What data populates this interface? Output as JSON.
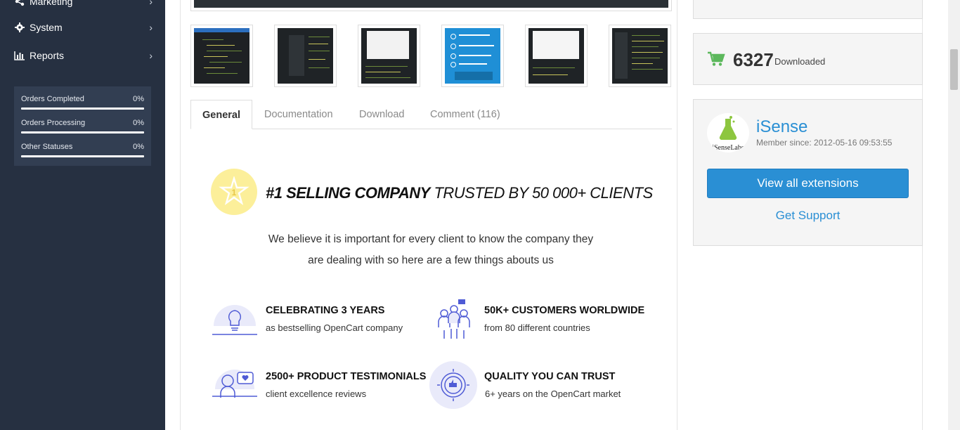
{
  "sidebar": {
    "items": [
      {
        "label": "Marketing",
        "icon": "share-icon"
      },
      {
        "label": "System",
        "icon": "gear-icon"
      },
      {
        "label": "Reports",
        "icon": "bar-chart-icon"
      }
    ],
    "stats": [
      {
        "label": "Orders Completed",
        "percent": "0%"
      },
      {
        "label": "Orders Processing",
        "percent": "0%"
      },
      {
        "label": "Other Statuses",
        "percent": "0%"
      }
    ]
  },
  "tabs": [
    {
      "label": "General",
      "active": true
    },
    {
      "label": "Documentation",
      "active": false
    },
    {
      "label": "Download",
      "active": false
    },
    {
      "label": "Comment (116)",
      "active": false
    }
  ],
  "description": {
    "headline_bold": "#1 SELLING COMPANY",
    "headline_rest": " TRUSTED BY 50 000+ CLIENTS",
    "intro_line1": "We believe it is important for every client to know the company they",
    "intro_line2": "are dealing with so here are a few things abouts us",
    "features": [
      {
        "title": "CELEBRATING 3 YEARS",
        "subtitle": "as bestselling OpenCart company",
        "icon": "lightbulb-icon"
      },
      {
        "title": "50K+ CUSTOMERS WORLDWIDE",
        "subtitle": "from 80 different countries",
        "icon": "customers-icon"
      },
      {
        "title": "2500+ PRODUCT TESTIMONIALS",
        "subtitle": "client excellence reviews",
        "icon": "testimonial-icon"
      },
      {
        "title": "QUALITY YOU CAN TRUST",
        "subtitle": "6+ years on the OpenCart market",
        "icon": "quality-badge-icon"
      }
    ]
  },
  "downloads": {
    "count": "6327",
    "label": "Downloaded"
  },
  "author": {
    "name": "iSense",
    "logo_text": "iSenseLabs",
    "member_since": "Member since: 2012-05-16 09:53:55",
    "view_button": "View all extensions",
    "support_link": "Get Support"
  },
  "colors": {
    "sidebar_bg": "#263041",
    "accent": "#2a8fd4",
    "cart_green": "#4caf50"
  }
}
